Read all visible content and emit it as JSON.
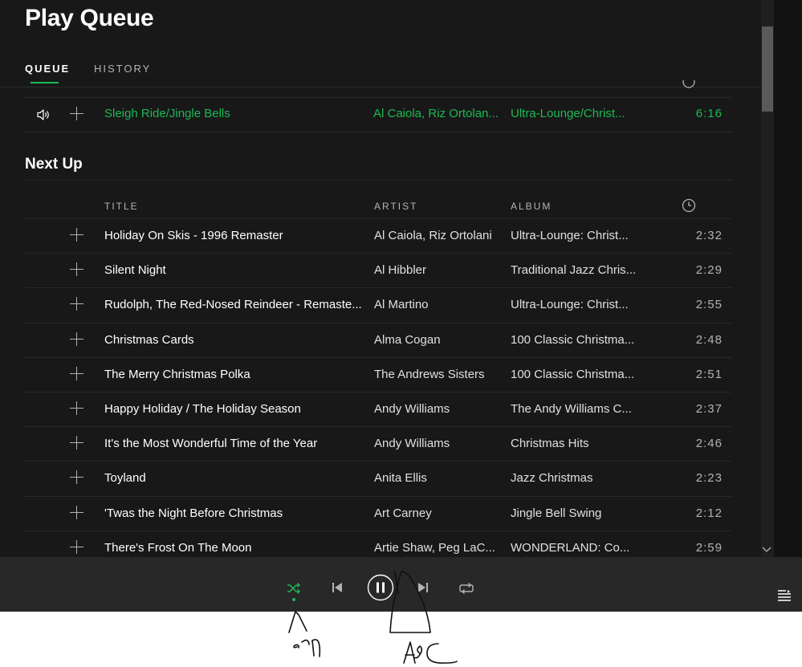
{
  "header": {
    "title": "Play Queue"
  },
  "tabs": [
    {
      "label": "QUEUE",
      "active": true
    },
    {
      "label": "HISTORY",
      "active": false
    }
  ],
  "now_playing": {
    "title": "Sleigh Ride/Jingle Bells",
    "artist": "Al Caiola, Riz Ortolan...",
    "album": "Ultra-Lounge/Christ...",
    "duration": "6:16"
  },
  "next_up": {
    "heading": "Next Up",
    "columns": {
      "title": "TITLE",
      "artist": "ARTIST",
      "album": "ALBUM",
      "duration_icon": "clock-icon"
    },
    "tracks": [
      {
        "title": "Holiday On Skis - 1996 Remaster",
        "artist": "Al Caiola, Riz Ortolani",
        "album": "Ultra-Lounge: Christ...",
        "duration": "2:32"
      },
      {
        "title": "Silent Night",
        "artist": "Al Hibbler",
        "album": "Traditional Jazz Chris...",
        "duration": "2:29"
      },
      {
        "title": "Rudolph, The Red-Nosed Reindeer - Remaste...",
        "artist": "Al Martino",
        "album": "Ultra-Lounge: Christ...",
        "duration": "2:55"
      },
      {
        "title": "Christmas Cards",
        "artist": "Alma Cogan",
        "album": "100 Classic Christma...",
        "duration": "2:48"
      },
      {
        "title": "The Merry Christmas Polka",
        "artist": "The Andrews Sisters",
        "album": "100 Classic Christma...",
        "duration": "2:51"
      },
      {
        "title": "Happy Holiday / The Holiday Season",
        "artist": "Andy Williams",
        "album": "The Andy Williams C...",
        "duration": "2:37"
      },
      {
        "title": "It's the Most Wonderful Time of the Year",
        "artist": "Andy Williams",
        "album": "Christmas Hits",
        "duration": "2:46"
      },
      {
        "title": "Toyland",
        "artist": "Anita Ellis",
        "album": "Jazz Christmas",
        "duration": "2:23"
      },
      {
        "title": "'Twas the Night Before Christmas",
        "artist": "Art Carney",
        "album": "Jingle Bell Swing",
        "duration": "2:12"
      },
      {
        "title": "There's Frost On The Moon",
        "artist": "Artie Shaw, Peg LaC...",
        "album": "WONDERLAND: Co...",
        "duration": "2:59"
      }
    ]
  },
  "player": {
    "shuffle_active": true,
    "controls": [
      "shuffle-icon",
      "previous-icon",
      "pause-icon",
      "next-icon",
      "repeat-icon",
      "queue-icon"
    ]
  },
  "colors": {
    "accent": "#1db954",
    "background": "#181818",
    "player_bar": "#282828"
  }
}
